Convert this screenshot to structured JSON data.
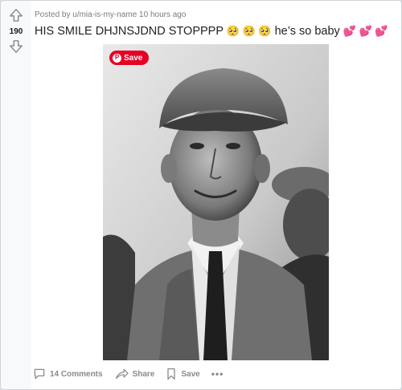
{
  "vote": {
    "count": "190",
    "upvote_icon": "arrow-up-outline",
    "downvote_icon": "arrow-down-outline"
  },
  "post": {
    "meta": "Posted by u/mia-is-my-name 10 hours ago",
    "title_text": "HIS SMILE DHJNSJDND STOPPPP",
    "title_emoji_1": "🥺 🥺 🥺",
    "title_tail": "he’s so baby",
    "title_emoji_2": "💕 💕 💕"
  },
  "image": {
    "pin_save_label": "Save",
    "pin_icon": "pinterest-logo",
    "description": "black-and-white photo of a smiling man in a flat cap and suit"
  },
  "actions": {
    "comments_label": "14 Comments",
    "share_label": "Share",
    "save_label": "Save",
    "more_label": "•••"
  },
  "colors": {
    "page_bg": "#dae0e6",
    "card_bg": "#ffffff",
    "muted": "#878a8c",
    "pinterest_red": "#e60023"
  }
}
